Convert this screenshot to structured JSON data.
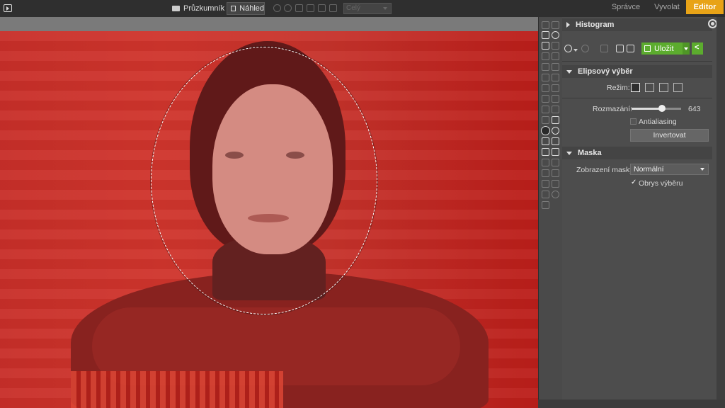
{
  "topbar": {
    "explorer_label": "Průzkumník",
    "preview_label": "Náhled",
    "zoom_value": "Celý",
    "tabs": [
      {
        "label": "Správce",
        "active": false
      },
      {
        "label": "Vyvolat",
        "active": false
      },
      {
        "label": "Editor",
        "active": true
      }
    ]
  },
  "panel": {
    "histogram_title": "Histogram",
    "save_label": "Uložit",
    "ellipse_section": {
      "title": "Elipsový výběr",
      "mode_label": "Režim:",
      "feather_label": "Rozmazání:",
      "feather_value": "643",
      "feather_fraction": 0.62,
      "antialiasing_label": "Antialiasing",
      "antialiasing_checked": false,
      "invert_label": "Invertovat"
    },
    "mask_section": {
      "title": "Maska",
      "display_label": "Zobrazení masky:",
      "display_value": "Normální",
      "outline_label": "Obrys výběru",
      "outline_checked": true
    }
  },
  "colors": {
    "accent": "#e8a317",
    "save_green": "#5cac2e",
    "panel_bg": "#4d4d4d",
    "topbar_bg": "#2f2f2f"
  }
}
